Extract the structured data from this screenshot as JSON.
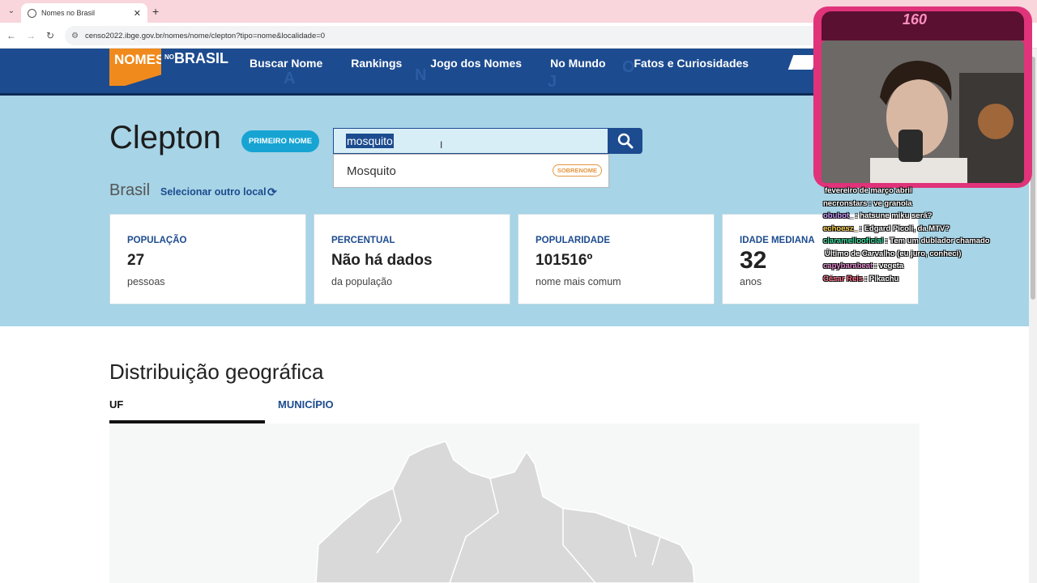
{
  "browser": {
    "tab_title": "Nomes no Brasil",
    "url": "censo2022.ibge.gov.br/nomes/nome/clepton?tipo=nome&localidade=0"
  },
  "header": {
    "logo_nomes": "NOMES",
    "logo_no": "NO",
    "logo_brasil": "BRASIL",
    "menu": [
      "Buscar Nome",
      "Rankings",
      "Jogo dos Nomes",
      "No Mundo",
      "Fatos e Curiosidades"
    ],
    "bg_letters": [
      "A",
      "N",
      "J",
      "O"
    ]
  },
  "hero": {
    "name": "Clepton",
    "badge": "PRIMEIRO NOME",
    "search": {
      "value": "mosquito",
      "suggestion": "Mosquito",
      "suggestion_tag": "SOBRENOME"
    },
    "location": "Brasil",
    "change_location": "Selecionar outro local",
    "cards": [
      {
        "label": "POPULAÇÃO",
        "value": "27",
        "sub": "pessoas"
      },
      {
        "label": "PERCENTUAL",
        "value": "Não há dados",
        "sub": "da população"
      },
      {
        "label": "POPULARIDADE",
        "value": "101516º",
        "sub": "nome mais comum"
      },
      {
        "label": "IDADE MEDIANA",
        "value": "32",
        "sub": "anos"
      }
    ]
  },
  "distribution": {
    "title": "Distribuição geográfica",
    "tabs": [
      "UF",
      "MUNICÍPIO"
    ]
  },
  "overlay": {
    "viewer_count": "160",
    "chat": [
      {
        "user": "",
        "msg": "fevereiro de março abril",
        "color": "#ffffff"
      },
      {
        "user": "necronstars",
        "msg": ": ve granola",
        "color": "#ffffff"
      },
      {
        "user": "obubot_",
        "msg": ": hatsune miku será?",
        "color": "#c99cff"
      },
      {
        "user": "echoesz_",
        "msg": ": Edgard Picoli, da MTV?",
        "color": "#ffd34d"
      },
      {
        "user": "claramellooficial",
        "msg": ": Tem um dublador chamado",
        "color": "#3de0a0"
      },
      {
        "user": "",
        "msg": "Último de Carvalho (eu juro, conheci)",
        "color": "#ffffff"
      },
      {
        "user": "capybarabeat",
        "msg": ": vegeta",
        "color": "#e58bd0"
      },
      {
        "user": "César Reis",
        "msg": ": Pikachu",
        "color": "#ff6f8a"
      }
    ]
  }
}
